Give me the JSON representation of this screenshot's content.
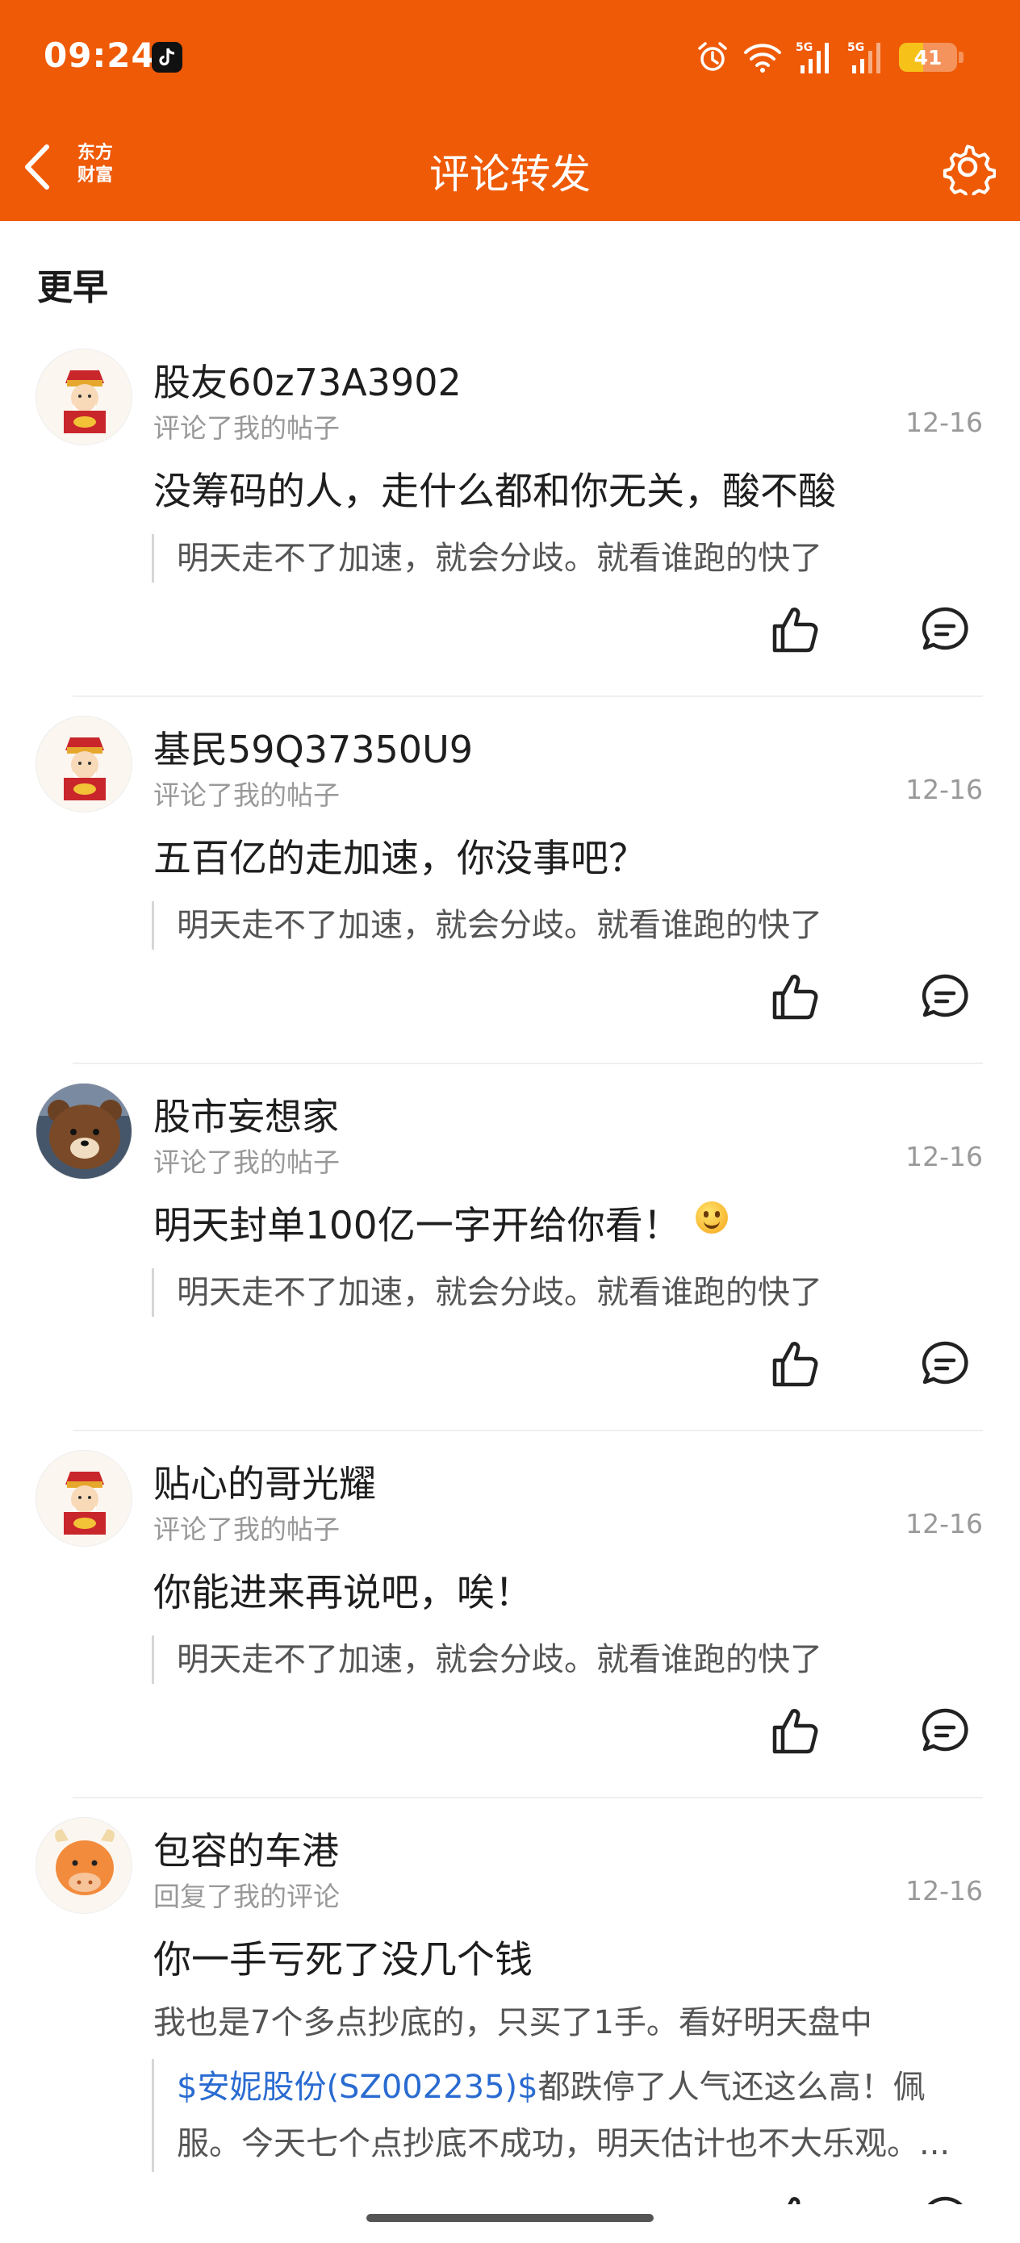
{
  "status_bar": {
    "time": "09:24",
    "battery": 41,
    "battery_label": "41",
    "network_labels": [
      "5G",
      "5G"
    ]
  },
  "nav": {
    "title": "评论转发",
    "logo_lines": [
      "东方",
      "财富"
    ]
  },
  "section_title": "更早",
  "items": [
    {
      "user": "股友60z73A3902",
      "action": "评论了我的帖子",
      "date": "12-16",
      "comment": "没筹码的人，走什么都和你无关，酸不酸",
      "quote": "明天走不了加速，就会分歧。就看谁跑的快了",
      "avatar": "caishen-avatar"
    },
    {
      "user": "基民59Q37350U9",
      "action": "评论了我的帖子",
      "date": "12-16",
      "comment": "五百亿的走加速，你没事吧？",
      "quote": "明天走不了加速，就会分歧。就看谁跑的快了",
      "avatar": "caishen-avatar"
    },
    {
      "user": "股市妄想家",
      "action": "评论了我的帖子",
      "date": "12-16",
      "comment": "明天封单100亿一字开给你看！",
      "quote": "明天走不了加速，就会分歧。就看谁跑的快了",
      "avatar": "bear-avatar"
    },
    {
      "user": "贴心的哥光耀",
      "action": "评论了我的帖子",
      "date": "12-16",
      "comment": "你能进来再说吧，唉！",
      "quote": "明天走不了加速，就会分歧。就看谁跑的快了",
      "avatar": "caishen-avatar"
    },
    {
      "user": "包容的车港",
      "action": "回复了我的评论",
      "date": "12-16",
      "comment": "你一手亏死了没几个钱",
      "reply_text": "我也是7个多点抄底的，只买了1手。看好明天盘中",
      "quote_stock": "$安妮股份(SZ002235)$",
      "quote_rest_line1": "都跌停了人气还这么高！佩",
      "quote_line2": "服。今天七个点抄底不成功，明天估计也不大乐观。...",
      "avatar": "ox-avatar"
    }
  ],
  "colors": {
    "brand": "#ef5a06",
    "link": "#2a6bd1"
  }
}
